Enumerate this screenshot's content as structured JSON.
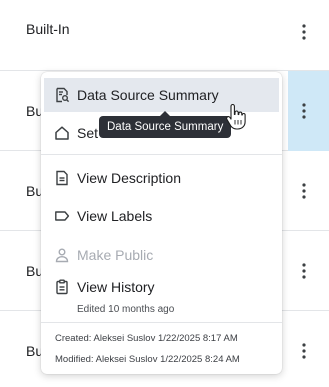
{
  "rows": [
    {
      "label": "Built-In"
    },
    {
      "label": "Bu"
    },
    {
      "label": "Bu"
    },
    {
      "label": "Bu"
    },
    {
      "label": "Bu"
    }
  ],
  "menu": {
    "items": [
      {
        "label": "Data Source Summary",
        "icon": "data-source-summary-icon",
        "state": "hover"
      },
      {
        "label": "Set",
        "icon": "home-icon",
        "state": "normal"
      },
      {
        "label": "View Description",
        "icon": "document-icon",
        "state": "normal"
      },
      {
        "label": "View Labels",
        "icon": "label-icon",
        "state": "normal"
      },
      {
        "label": "Make Public",
        "icon": "person-icon",
        "state": "disabled"
      },
      {
        "label": "View History",
        "icon": "clipboard-icon",
        "state": "normal"
      }
    ],
    "history_sub": "Edited 10 months ago",
    "created": "Created: Aleksei Suslov 1/22/2025 8:17 AM",
    "modified": "Modified: Aleksei Suslov 1/22/2025 8:24 AM"
  },
  "tooltip": {
    "text": "Data Source Summary"
  },
  "colors": {
    "hover_bg": "#e4e8ee",
    "selected_kebab_bg": "#cfe8f7",
    "tooltip_bg": "#2d3037",
    "disabled_text": "#a7abb2"
  }
}
